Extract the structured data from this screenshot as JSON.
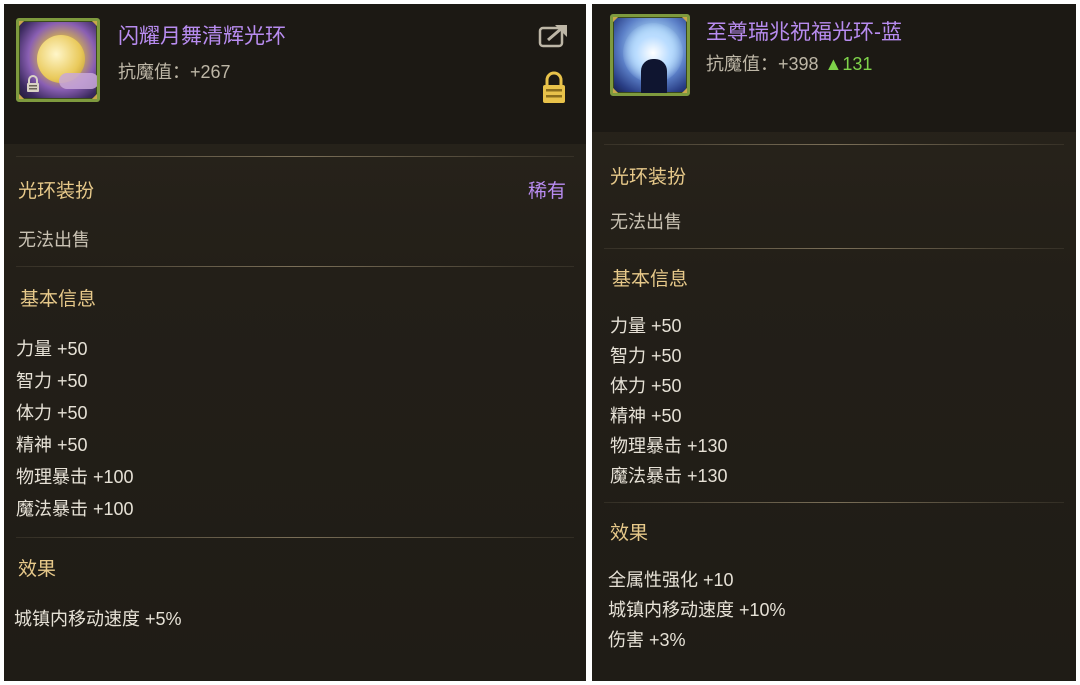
{
  "left_panel": {
    "title": "闪耀月舞清辉光环",
    "resist_label": "抗魔值：+267",
    "icons": [
      "share-icon",
      "lock-icon"
    ],
    "category": "光环装扮",
    "rarity": "稀有",
    "sell_status": "无法出售",
    "basic_info_title": "基本信息",
    "attributes": [
      "力量 +50",
      "智力 +50",
      "体力 +50",
      "精神 +50",
      "物理暴击 +100",
      "魔法暴击 +100"
    ],
    "effect_title": "效果",
    "effects": [
      "城镇内移动速度 +5%"
    ]
  },
  "right_panel": {
    "title": "至尊瑞兆祝福光环-蓝",
    "resist_label": "抗魔值：+398",
    "resist_increase": "▲131",
    "category": "光环装扮",
    "sell_status": "无法出售",
    "basic_info_title": "基本信息",
    "attributes": [
      "力量 +50",
      "智力 +50",
      "体力 +50",
      "精神 +50",
      "物理暴击 +130",
      "魔法暴击 +130"
    ],
    "effect_title": "效果",
    "effects": [
      "全属性强化 +10",
      "城镇内移动速度 +10%",
      "伤害 +3%"
    ]
  },
  "colors": {
    "title_purple": "#b88cf0",
    "section_gold": "#e7c98a",
    "increase_green": "#7ed24a",
    "panel_bg": "#231f18"
  }
}
